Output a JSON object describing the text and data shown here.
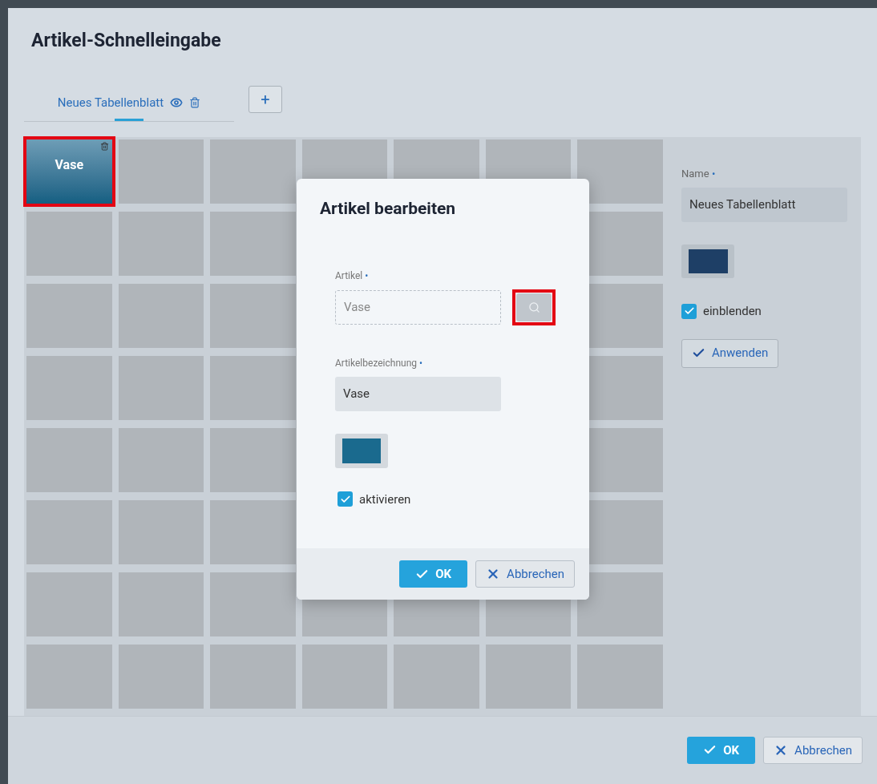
{
  "window": {
    "title": "Artikel-Schnelleingabe"
  },
  "tabs": [
    {
      "label": "Neues Tabellenblatt",
      "selected": true
    }
  ],
  "add_tab": {
    "label": "+"
  },
  "grid_rows": [
    [
      {
        "kind": "item",
        "label": "Vase",
        "highlighted": true
      },
      {
        "kind": "empty"
      },
      {
        "kind": "empty"
      },
      {
        "kind": "empty"
      },
      {
        "kind": "empty"
      },
      {
        "kind": "empty"
      },
      {
        "kind": "empty"
      }
    ],
    [
      {
        "kind": "empty"
      },
      {
        "kind": "empty"
      },
      {
        "kind": "empty"
      },
      {
        "kind": "covered"
      },
      {
        "kind": "covered"
      },
      {
        "kind": "covered"
      },
      {
        "kind": "empty"
      }
    ],
    [
      {
        "kind": "empty"
      },
      {
        "kind": "empty"
      },
      {
        "kind": "empty"
      },
      {
        "kind": "covered"
      },
      {
        "kind": "covered"
      },
      {
        "kind": "covered"
      },
      {
        "kind": "empty"
      }
    ],
    [
      {
        "kind": "empty"
      },
      {
        "kind": "empty"
      },
      {
        "kind": "empty"
      },
      {
        "kind": "covered"
      },
      {
        "kind": "covered"
      },
      {
        "kind": "covered"
      },
      {
        "kind": "empty"
      }
    ],
    [
      {
        "kind": "empty"
      },
      {
        "kind": "empty"
      },
      {
        "kind": "empty"
      },
      {
        "kind": "covered"
      },
      {
        "kind": "covered"
      },
      {
        "kind": "covered"
      },
      {
        "kind": "empty"
      }
    ],
    [
      {
        "kind": "empty"
      },
      {
        "kind": "empty"
      },
      {
        "kind": "empty"
      },
      {
        "kind": "covered"
      },
      {
        "kind": "covered"
      },
      {
        "kind": "covered"
      },
      {
        "kind": "empty"
      }
    ],
    [
      {
        "kind": "empty"
      },
      {
        "kind": "empty"
      },
      {
        "kind": "empty"
      },
      {
        "kind": "empty"
      },
      {
        "kind": "empty"
      },
      {
        "kind": "empty"
      },
      {
        "kind": "empty"
      }
    ],
    [
      {
        "kind": "empty"
      },
      {
        "kind": "empty"
      },
      {
        "kind": "empty"
      },
      {
        "kind": "empty"
      },
      {
        "kind": "empty"
      },
      {
        "kind": "empty"
      },
      {
        "kind": "empty"
      }
    ]
  ],
  "sheet_panel": {
    "name_label": "Name",
    "name_required_mark": "•",
    "name_value": "Neues Tabellenblatt",
    "show_checkbox": {
      "label": "einblenden",
      "checked": true
    },
    "apply_button": "Anwenden"
  },
  "dialog": {
    "title": "Artikel bearbeiten",
    "article_label": "Artikel",
    "article_required_mark": "•",
    "article_value": "Vase",
    "search_highlighted": true,
    "description_label": "Artikelbezeichnung",
    "description_required_mark": "•",
    "description_value": "Vase",
    "activate_checkbox": {
      "label": "aktivieren",
      "checked": true
    },
    "ok": "OK",
    "cancel": "Abbrechen"
  },
  "footer": {
    "ok": "OK",
    "cancel": "Abbrechen"
  }
}
